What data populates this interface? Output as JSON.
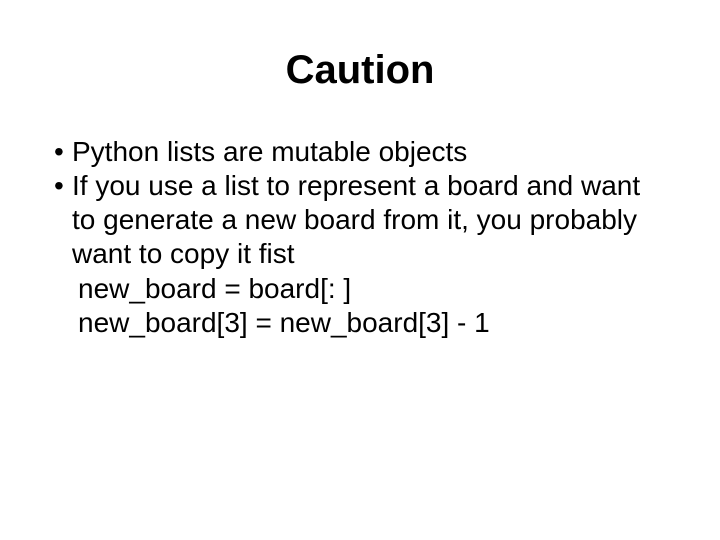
{
  "slide": {
    "title": "Caution",
    "bullets": [
      "Python lists are mutable objects",
      "If you use a list to represent a board and want to generate a new board from it, you probably want to copy it fist"
    ],
    "code_lines": [
      "new_board = board[: ]",
      "new_board[3] = new_board[3] - 1"
    ],
    "bullet_glyph": "•"
  }
}
